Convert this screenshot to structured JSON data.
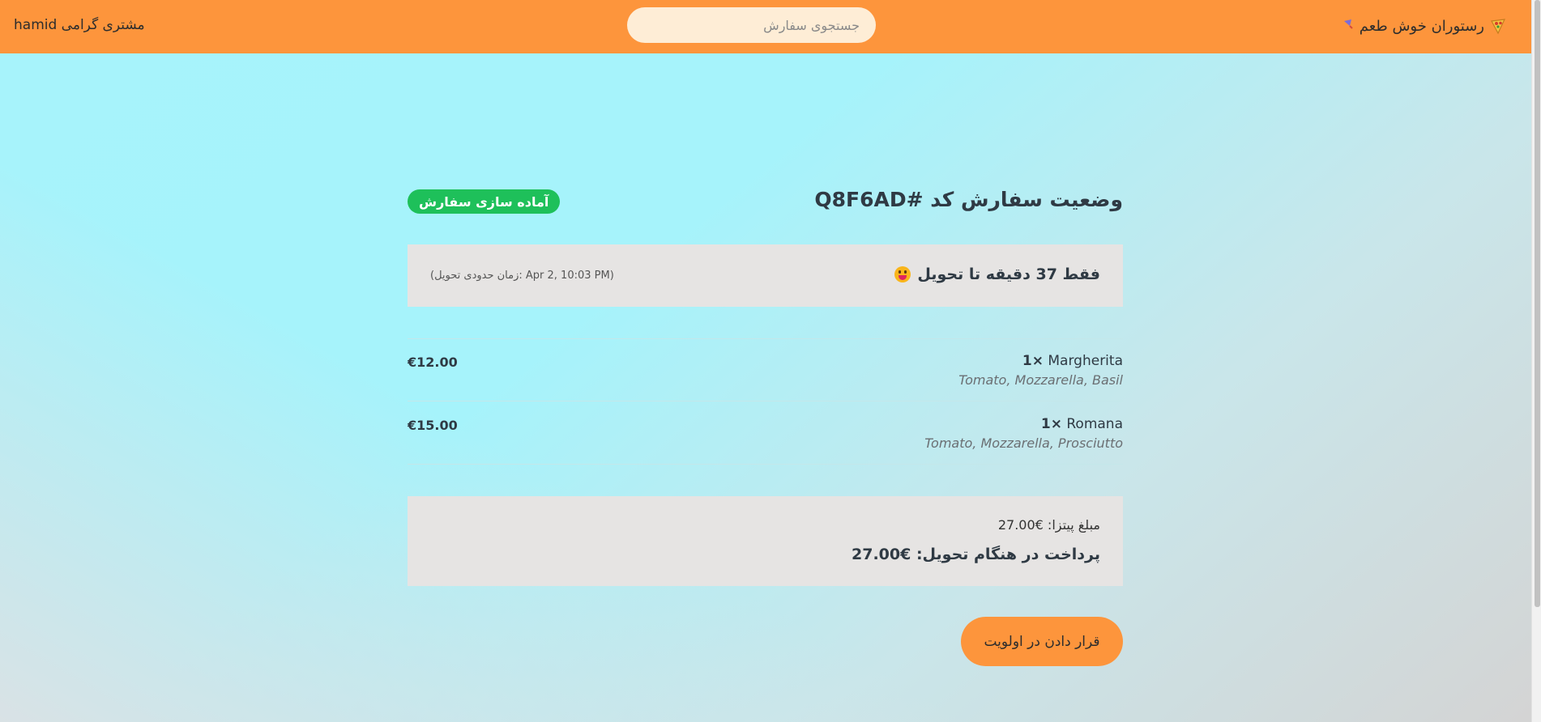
{
  "navbar": {
    "brand": "رستوران خوش طعم",
    "brand_logo": "pizza-logo-icon",
    "search_placeholder": "جستجوی سفارش",
    "customer_label": "مشتری گرامی hamid",
    "bg_color": "#fd953c"
  },
  "order": {
    "title": "وضعیت سفارش کد #Q8F6AD",
    "status_badge": "آماده سازی سفارش",
    "status_color": "#1ec05a",
    "eta_main": "فقط 37 دقیقه تا تحویل",
    "eta_icon": "grinning-face-icon",
    "eta_sub": "(زمان حدودی تحویل: Apr 2, 10:03 PM)"
  },
  "items": [
    {
      "qty": "1×",
      "name": "Margherita",
      "ingredients": "Tomato, Mozzarella, Basil",
      "price": "€12.00"
    },
    {
      "qty": "1×",
      "name": "Romana",
      "ingredients": "Tomato, Mozzarella, Prosciutto",
      "price": "€15.00"
    }
  ],
  "summary": {
    "pizza_price": "مبلغ پیتزا: €27.00",
    "pay_on_delivery": "پرداخت در هنگام تحویل: €27.00"
  },
  "actions": {
    "priority_label": "قرار دادن در اولویت",
    "priority_color": "#fd953c"
  }
}
